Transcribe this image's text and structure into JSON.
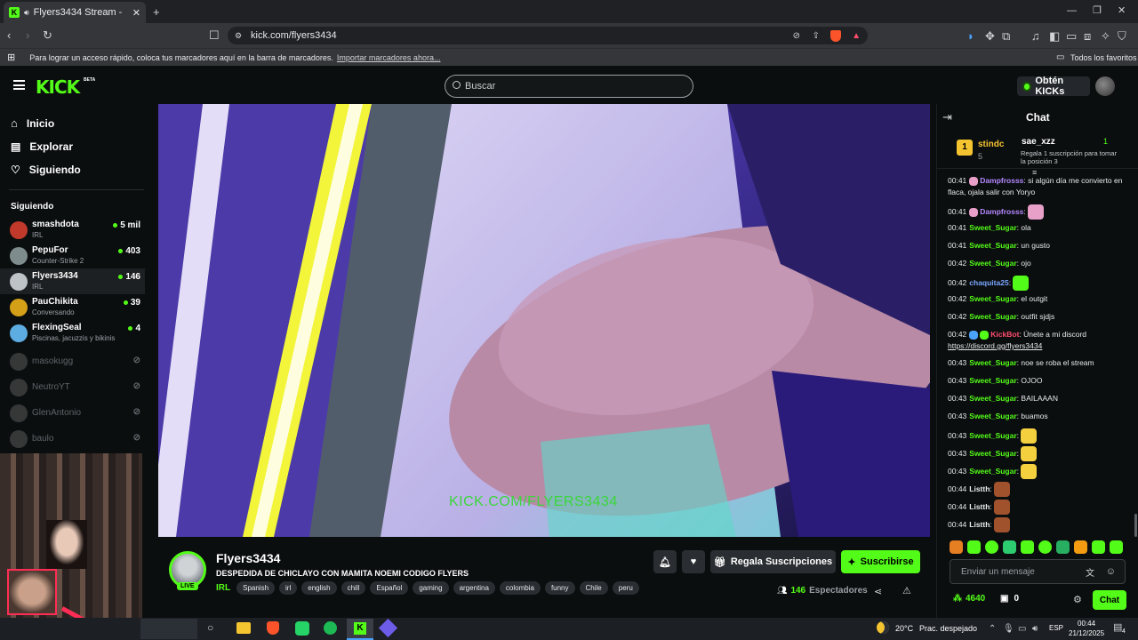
{
  "browser": {
    "tab_title": "Flyers3434 Stream - Watch Li",
    "url": "kick.com/flyers3434",
    "bookmark_hint": "Para lograr un acceso rápido, coloca tus marcadores aquí en la barra de marcadores.",
    "bookmark_import": "Importar marcadores ahora...",
    "favorites": "Todos los favoritos"
  },
  "header": {
    "logo": "KICK",
    "logo_beta": "BETA",
    "search_placeholder": "Buscar",
    "kicks_button": "Obtén KICKs"
  },
  "sidebar": {
    "nav": [
      {
        "label": "Inicio",
        "icon": "home-icon"
      },
      {
        "label": "Explorar",
        "icon": "compass-icon"
      },
      {
        "label": "Siguiendo",
        "icon": "heart-icon"
      }
    ],
    "following_title": "Siguiendo",
    "following": [
      {
        "name": "smashdota",
        "category": "IRL",
        "viewers": "5 mil",
        "live": true,
        "color": "#c0392b"
      },
      {
        "name": "PepuFor",
        "category": "Counter-Strike 2",
        "viewers": "403",
        "live": true,
        "color": "#7f8c8d"
      },
      {
        "name": "Flyers3434",
        "category": "IRL",
        "viewers": "146",
        "live": true,
        "color": "#bdc3c7"
      },
      {
        "name": "PauChikita",
        "category": "Conversando",
        "viewers": "39",
        "live": true,
        "color": "#d4a017"
      },
      {
        "name": "FlexingSeal",
        "category": "Piscinas, jacuzzis y bikinis",
        "viewers": "4",
        "live": true,
        "color": "#5dade2"
      },
      {
        "name": "masokugg",
        "live": false,
        "color": "#888"
      },
      {
        "name": "NeutroYT",
        "live": false,
        "color": "#888"
      },
      {
        "name": "GlenAntonio",
        "live": false,
        "color": "#888"
      },
      {
        "name": "baulo",
        "live": false,
        "color": "#888"
      }
    ]
  },
  "video": {
    "watermark": "KICK.COM/FLYERS3434"
  },
  "stream_info": {
    "channel": "Flyers3434",
    "live_badge": "LIVE",
    "title": "DESPEDIDA DE CHICLAYO CON MAMITA NOEMI CODIGO FLYERS",
    "category": "IRL",
    "tags": [
      "Spanish",
      "irl",
      "english",
      "chill",
      "Español",
      "gaming",
      "argentina",
      "colombia",
      "funny",
      "Chile",
      "peru"
    ],
    "gift_button": "Regala Suscripciones",
    "subscribe_button": "Suscribirse",
    "viewers": "146",
    "viewers_label": "Espectadores"
  },
  "chat": {
    "title": "Chat",
    "leaderboard": {
      "rank": "1",
      "top_user": "stindc",
      "top_count": "5",
      "second_user": "sae_xzz",
      "second_count": "1",
      "gift_hint": "Regala 1 suscripción para tomar la posición 3"
    },
    "messages": [
      {
        "time": "00:41",
        "user": "Dampfrosss",
        "color": "#b388ff",
        "text": "si algún día me convierto en flaca, ojala salir con Yoryo"
      },
      {
        "time": "00:41",
        "user": "Dampfrosss",
        "color": "#b388ff",
        "text": "",
        "emote": "#e8a0c8"
      },
      {
        "time": "00:41",
        "user": "Sweet_Sugar",
        "color": "#53fc18",
        "text": "ola"
      },
      {
        "time": "00:41",
        "user": "Sweet_Sugar",
        "color": "#53fc18",
        "text": "un gusto"
      },
      {
        "time": "00:42",
        "user": "Sweet_Sugar",
        "color": "#53fc18",
        "text": "ojo"
      },
      {
        "time": "00:42",
        "user": "chaquita25",
        "color": "#7aa7ff",
        "text": "",
        "emote": "#53fc18"
      },
      {
        "time": "00:42",
        "user": "Sweet_Sugar",
        "color": "#53fc18",
        "text": "el outgit"
      },
      {
        "time": "00:42",
        "user": "Sweet_Sugar",
        "color": "#53fc18",
        "text": "outfit sjdjs"
      },
      {
        "time": "00:42",
        "user": "KickBot",
        "color": "#ff4d6d",
        "text": "Únete a mi discord",
        "link": "https://discord.gg/flyers3434"
      },
      {
        "time": "00:43",
        "user": "Sweet_Sugar",
        "color": "#53fc18",
        "text": "noe se roba el stream"
      },
      {
        "time": "00:43",
        "user": "Sweet_Sugar",
        "color": "#53fc18",
        "text": "OJOO"
      },
      {
        "time": "00:43",
        "user": "Sweet_Sugar",
        "color": "#53fc18",
        "text": "BAILAAAN"
      },
      {
        "time": "00:43",
        "user": "Sweet_Sugar",
        "color": "#53fc18",
        "text": "buamos"
      },
      {
        "time": "00:43",
        "user": "Sweet_Sugar",
        "color": "#53fc18",
        "text": "",
        "emote": "#f4d03f"
      },
      {
        "time": "00:43",
        "user": "Sweet_Sugar",
        "color": "#53fc18",
        "text": "",
        "emote": "#f4d03f"
      },
      {
        "time": "00:43",
        "user": "Sweet_Sugar",
        "color": "#53fc18",
        "text": "",
        "emote": "#f4d03f"
      },
      {
        "time": "00:44",
        "user": "Listth",
        "color": "#e8eaed",
        "text": "",
        "emote": "#a0522d"
      },
      {
        "time": "00:44",
        "user": "Listth",
        "color": "#e8eaed",
        "text": "",
        "emote": "#a0522d"
      },
      {
        "time": "00:44",
        "user": "Listth",
        "color": "#e8eaed",
        "text": "",
        "emote": "#a0522d"
      }
    ],
    "input_placeholder": "Enviar un mensaje",
    "points": "4640",
    "vault": "0",
    "send_button": "Chat"
  },
  "taskbar": {
    "weather": "20°C",
    "weather_text": "Prac. despejado",
    "lang": "ESP",
    "time": "00:44",
    "date": "21/12/2025",
    "notifications": "4"
  },
  "colors": {
    "accent": "#53fc18",
    "bg": "#0b0e0f"
  }
}
